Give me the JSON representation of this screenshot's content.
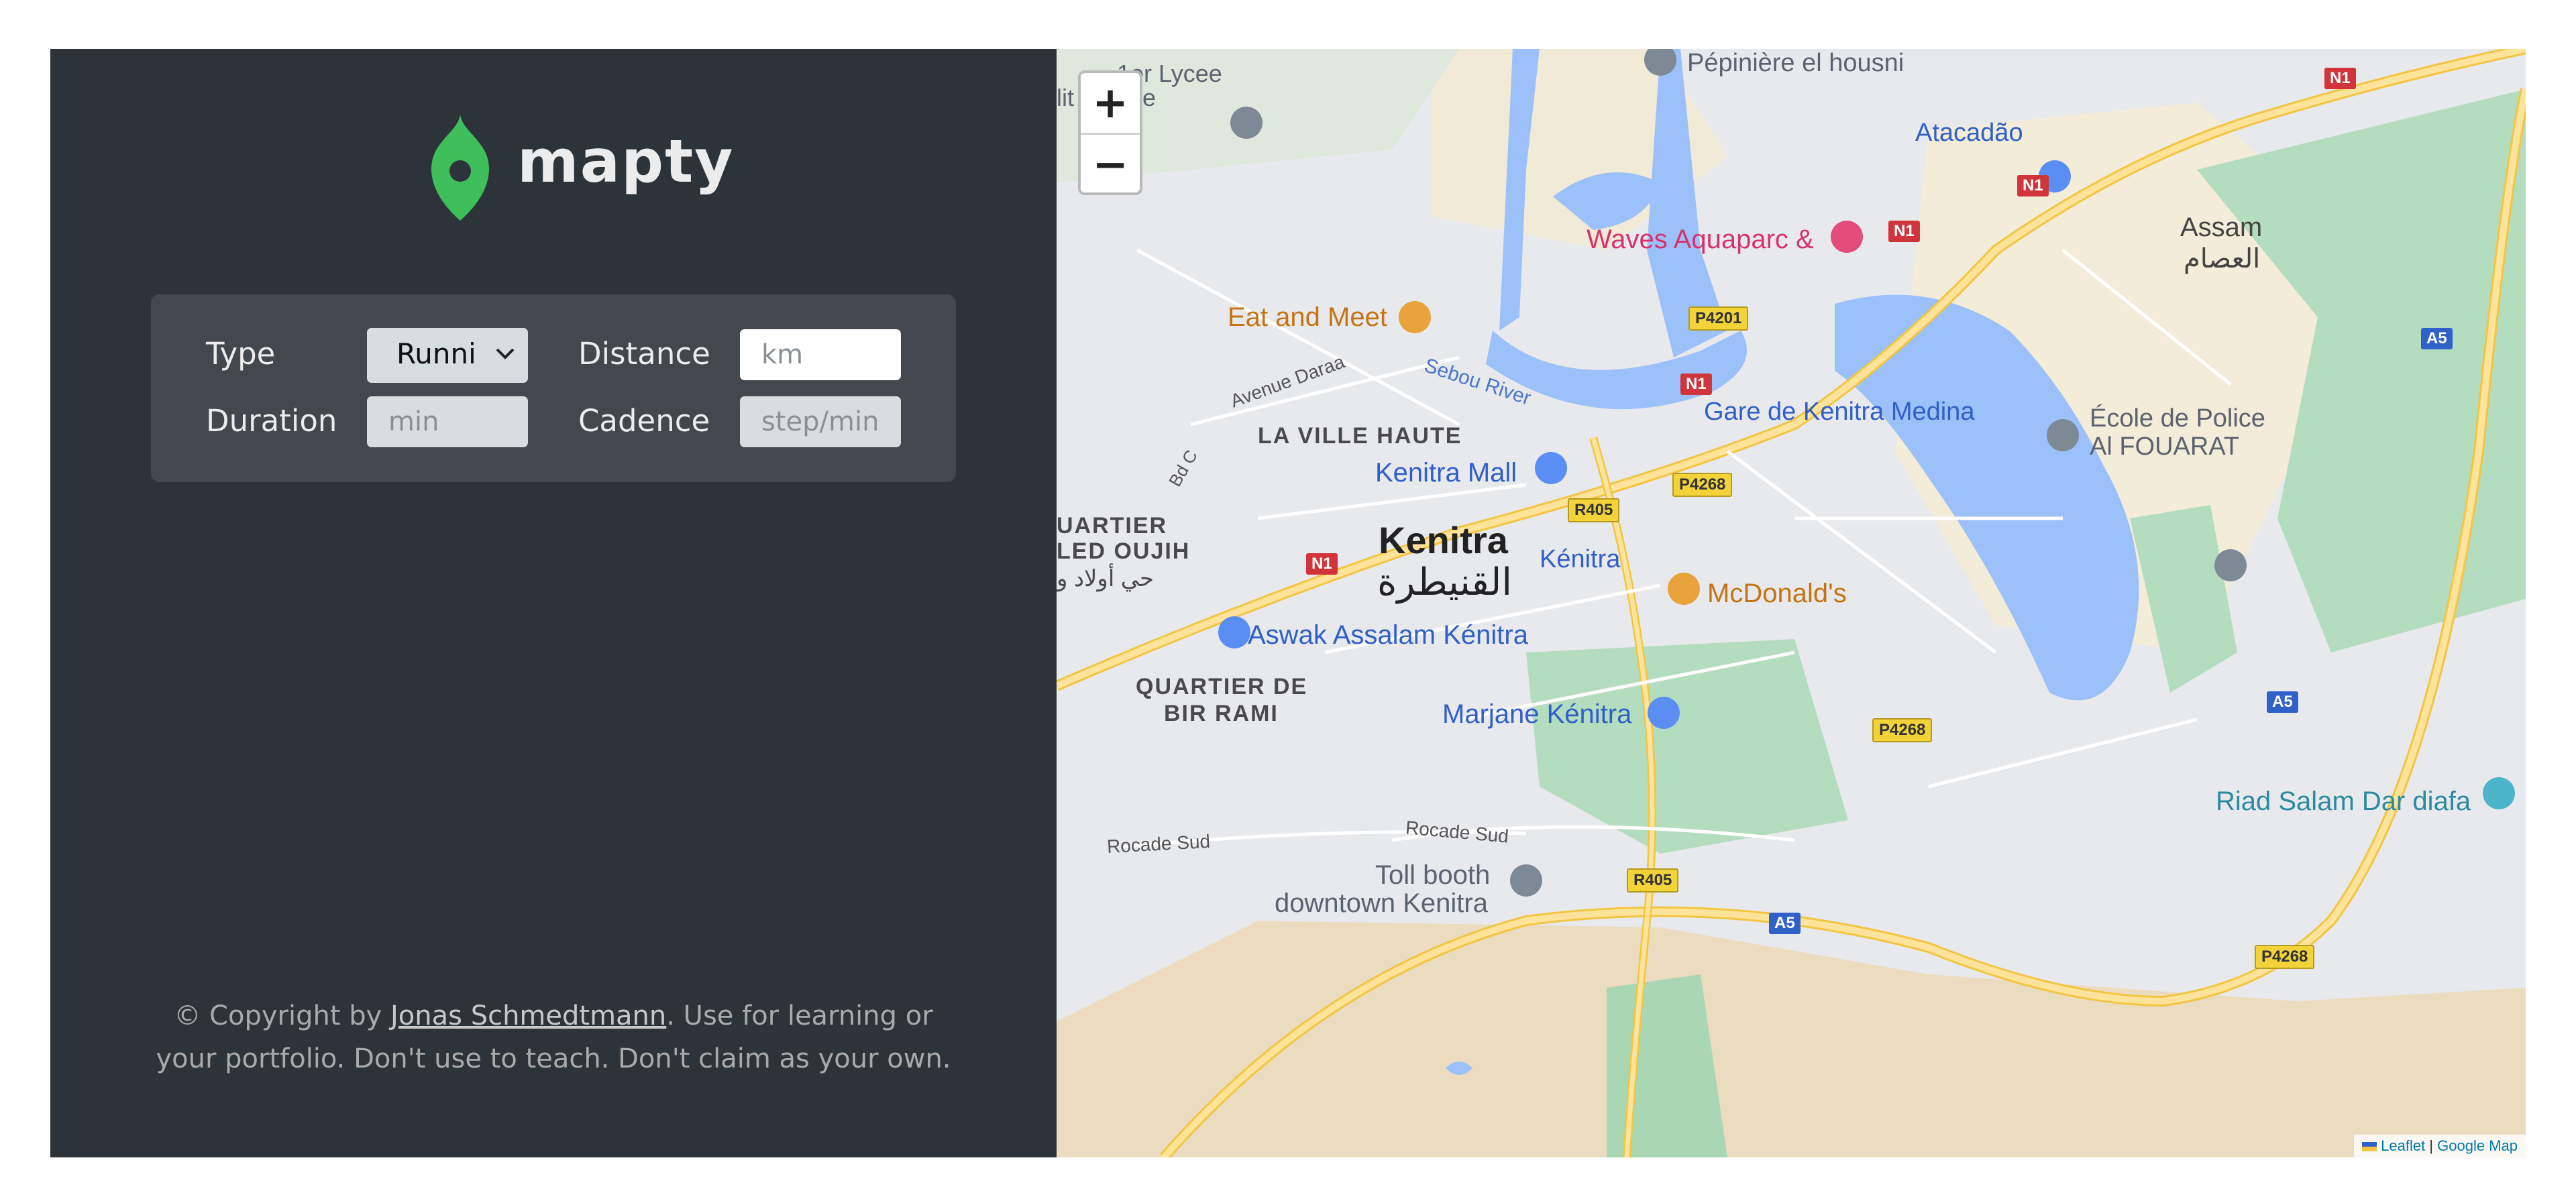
{
  "brand": {
    "name": "mapty"
  },
  "form": {
    "type_label": "Type",
    "type_value": "Runni",
    "distance_label": "Distance",
    "distance_placeholder": "km",
    "duration_label": "Duration",
    "duration_placeholder": "min",
    "cadence_label": "Cadence",
    "cadence_placeholder": "step/min"
  },
  "footer": {
    "prefix": "© Copyright by ",
    "author": "Jonas Schmedtmann",
    "suffix": ". Use for learning or your portfolio. Don't use to teach. Don't claim as your own."
  },
  "map": {
    "zoom_in": "+",
    "zoom_out": "−",
    "attribution_leaflet": "Leaflet",
    "attribution_sep": " | ",
    "attribution_google": "Google Map",
    "labels": {
      "pepiniere": "Pépinière el housni",
      "lycee": "1er Lycee",
      "royale": "lit Royale",
      "atacadao": "Atacadão",
      "waves": "Waves Aquaparc &",
      "assam": "Assam",
      "assam_ar": "العصام",
      "eat_meet": "Eat and Meet",
      "avenue_daraa": "Avenue Daraa",
      "sebou": "Sebou River",
      "gare": "Gare de Kenitra Medina",
      "ecole1": "École de Police",
      "ecole2": "Al FOUARAT",
      "ville_haute": "LA VILLE HAUTE",
      "kenitra_mall": "Kenitra Mall",
      "bd_c": "Bd C",
      "quartier1": "UARTIER",
      "oujih": "LED OUJIH",
      "oujih_ar": "حي أولاد و",
      "kenitra": "Kenitra",
      "kenitra_ar": "القنيطرة",
      "kenitra_station": "Kénitra",
      "mcdonalds": "McDonald's",
      "aswak": "Aswak Assalam Kénitra",
      "bir_rami1": "QUARTIER DE",
      "bir_rami2": "BIR RAMI",
      "marjane": "Marjane Kénitra",
      "riad": "Riad Salam Dar diafa",
      "rocade_sud_1": "Rocade Sud",
      "rocade_sud_2": "Rocade Sud",
      "toll1": "Toll booth",
      "toll2": "downtown Kenitra"
    },
    "shields": {
      "n1_a": "N1",
      "n1_b": "N1",
      "n1_c": "N1",
      "n1_d": "N1",
      "n1_e": "N1",
      "p4201": "P4201",
      "p4268_a": "P4268",
      "p4268_b": "P4268",
      "p4268_c": "P4268",
      "r405_a": "R405",
      "r405_b": "R405",
      "a5_a": "A5",
      "a5_b": "A5",
      "a5_c": "A5"
    }
  },
  "colors": {
    "sidebar_bg": "#2d3439",
    "form_bg": "#42484d",
    "brand_green": "#00c46a",
    "water": "#9cc0f9",
    "park": "#a8dab5",
    "road_major": "#fcd765"
  }
}
